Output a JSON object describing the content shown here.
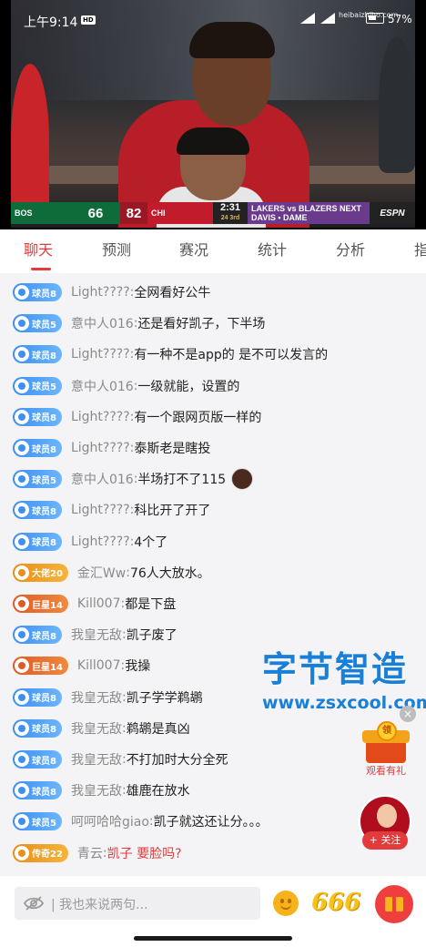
{
  "status_bar": {
    "time": "上午9:14",
    "hd_badge": "HD",
    "battery": "57%",
    "battery_level": 0.57,
    "watermark_logo": "heibaizhibo.com"
  },
  "scoreboard": {
    "team1": "BOS",
    "team1_record": "33-31 (8th IN EAST)",
    "score1": "66",
    "score2": "82",
    "team2": "CHI",
    "team2_record": "27-38 (11th IN EAST)",
    "clock": "2:31",
    "quarter": "24 3rd",
    "promo": "LAKERS vs BLAZERS NEXT DAVIS • DAME",
    "network": "ESPN"
  },
  "tabs": [
    {
      "label": "聊天",
      "active": true
    },
    {
      "label": "预测",
      "active": false
    },
    {
      "label": "赛况",
      "active": false
    },
    {
      "label": "统计",
      "active": false
    },
    {
      "label": "分析",
      "active": false
    },
    {
      "label": "指",
      "active": false
    }
  ],
  "messages": [
    {
      "badge": "球员8",
      "badge_color": "blue",
      "user": "Light????",
      "text": "全网看好公牛"
    },
    {
      "badge": "球员5",
      "badge_color": "blue",
      "user": "意中人016",
      "text": "还是看好凯子，下半场"
    },
    {
      "badge": "球员8",
      "badge_color": "blue",
      "user": "Light????",
      "text": "有一种不是app的 是不可以发言的"
    },
    {
      "badge": "球员5",
      "badge_color": "blue",
      "user": "意中人016",
      "text": "一级就能，设置的"
    },
    {
      "badge": "球员8",
      "badge_color": "blue",
      "user": "Light????",
      "text": "有一个跟网页版一样的"
    },
    {
      "badge": "球员8",
      "badge_color": "blue",
      "user": "Light????",
      "text": "泰斯老是瞎投"
    },
    {
      "badge": "球员5",
      "badge_color": "blue",
      "user": "意中人016",
      "text": "半场打不了115",
      "emoji": "face-emoji"
    },
    {
      "badge": "球员8",
      "badge_color": "blue",
      "user": "Light????",
      "text": "科比开了开了"
    },
    {
      "badge": "球员8",
      "badge_color": "blue",
      "user": "Light????",
      "text": "4个了"
    },
    {
      "badge": "大佬20",
      "badge_color": "gold",
      "user": "金汇Ww",
      "text": "76人大放水。"
    },
    {
      "badge": "巨星14",
      "badge_color": "orange",
      "user": "Kill007",
      "text": "都是下盘"
    },
    {
      "badge": "球员8",
      "badge_color": "blue",
      "user": "我皇无敌",
      "text": "凯子废了"
    },
    {
      "badge": "巨星14",
      "badge_color": "orange",
      "user": "Kill007",
      "text": "我操"
    },
    {
      "badge": "球员8",
      "badge_color": "blue",
      "user": "我皇无敌",
      "text": "凯子学学鹈鹕"
    },
    {
      "badge": "球员8",
      "badge_color": "blue",
      "user": "我皇无敌",
      "text": "鹈鹕是真凶"
    },
    {
      "badge": "球员8",
      "badge_color": "blue",
      "user": "我皇无敌",
      "text": "不打加时大分全死"
    },
    {
      "badge": "球员8",
      "badge_color": "blue",
      "user": "我皇无敌",
      "text": "雄鹿在放水"
    },
    {
      "badge": "球员5",
      "badge_color": "blue",
      "user": "呵呵哈哈giao",
      "text": "凯子就这还让分。。。"
    },
    {
      "badge": "传奇22",
      "badge_color": "gold",
      "user": "青云",
      "text": "凯子 要脸吗?",
      "text_color": "red"
    }
  ],
  "overlay": {
    "watermark_title": "字节智造",
    "watermark_url": "www.zsxcool.com",
    "gift_coin": "领",
    "gift_label": "观看有礼",
    "follow_label": "+ 关注",
    "close": "×"
  },
  "bottom_bar": {
    "input_placeholder": "| 我也来说两句...",
    "emoji_icon": "smile-icon",
    "quick_666": "666",
    "gift_icon": "gift-icon"
  }
}
